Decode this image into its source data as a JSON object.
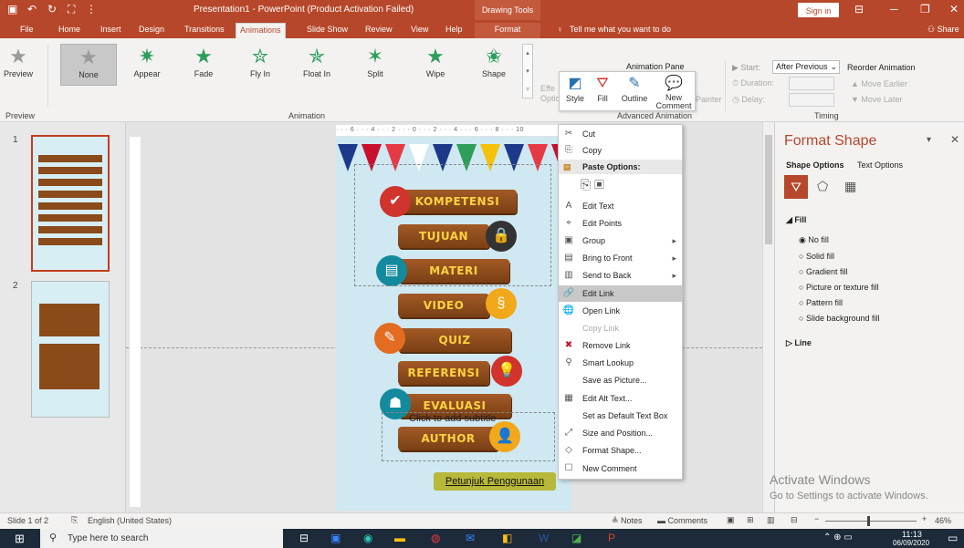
{
  "titlebar": {
    "title": "Presentation1 - PowerPoint (Product Activation Failed)",
    "context_header": "Drawing Tools",
    "signin": "Sign in",
    "accent": "#b7472a"
  },
  "tabs": [
    "File",
    "Home",
    "Insert",
    "Design",
    "Transitions",
    "Animations",
    "Slide Show",
    "Review",
    "View",
    "Help",
    "Format"
  ],
  "tell_me": "Tell me what you want to do",
  "share": "Share",
  "ribbon": {
    "preview_label": "Preview",
    "preview_group": "Preview",
    "animations": [
      "None",
      "Appear",
      "Fade",
      "Fly In",
      "Float In",
      "Split",
      "Wipe",
      "Shape"
    ],
    "animation_group": "Animation",
    "effect_label": "Effe Optio",
    "animation_pane": "Animation Pane",
    "painter": "Painter",
    "advanced_group": "Advanced Animation",
    "start_label": "Start:",
    "start_value": "After Previous",
    "duration_label": "Duration:",
    "delay_label": "Delay:",
    "reorder": "Reorder Animation",
    "move_earlier": "Move Earlier",
    "move_later": "Move Later",
    "timing_group": "Timing"
  },
  "minitoolbar": {
    "style": "Style",
    "fill": "Fill",
    "outline": "Outline",
    "comment": "New Comment"
  },
  "slides": {
    "nums": [
      "1",
      "2"
    ]
  },
  "slide": {
    "planks": [
      "KOMPETENSI",
      "TUJUAN",
      "MATERI",
      "VIDEO",
      "QUIZ",
      "REFERENSI",
      "EVALUASI",
      "AUTHOR"
    ],
    "placeholder": "Click to add subtitle",
    "petunjuk": "Petunjuk Penggunaan"
  },
  "ruler_top": "· · · 6 · · · 4 · · · 2 · · · 0 · · · 2 · · · 4 · · · 6 · · · 8 · · · 10",
  "context_menu": {
    "items1": [
      {
        "icon": "✂",
        "label": "Cut"
      },
      {
        "icon": "⎘",
        "label": "Copy"
      }
    ],
    "paste_header": "Paste Options:",
    "items2": [
      {
        "icon": "A",
        "label": "Edit Text",
        "arrow": ""
      },
      {
        "icon": "⌖",
        "label": "Edit Points",
        "arrow": ""
      },
      {
        "icon": "▣",
        "label": "Group",
        "arrow": "▸"
      },
      {
        "icon": "▤",
        "label": "Bring to Front",
        "arrow": "▸"
      },
      {
        "icon": "▥",
        "label": "Send to Back",
        "arrow": "▸"
      },
      {
        "icon": "🔗",
        "label": "Edit Link",
        "arrow": ""
      },
      {
        "icon": "🌐",
        "label": "Open Link",
        "arrow": ""
      },
      {
        "icon": "",
        "label": "Copy Link",
        "arrow": ""
      },
      {
        "icon": "✖",
        "label": "Remove Link",
        "arrow": ""
      },
      {
        "icon": "⚲",
        "label": "Smart Lookup",
        "arrow": ""
      },
      {
        "icon": "",
        "label": "Save as Picture...",
        "arrow": ""
      },
      {
        "icon": "▦",
        "label": "Edit Alt Text...",
        "arrow": ""
      },
      {
        "icon": "",
        "label": "Set as Default Text Box",
        "arrow": ""
      },
      {
        "icon": "⤢",
        "label": "Size and Position...",
        "arrow": ""
      },
      {
        "icon": "◇",
        "label": "Format Shape...",
        "arrow": ""
      },
      {
        "icon": "☐",
        "label": "New Comment",
        "arrow": ""
      }
    ]
  },
  "format_pane": {
    "title": "Format Shape",
    "tab_shape": "Shape Options",
    "tab_text": "Text Options",
    "fill_section": "Fill",
    "fill_options": [
      "No fill",
      "Solid fill",
      "Gradient fill",
      "Picture or texture fill",
      "Pattern fill",
      "Slide background fill"
    ],
    "line_section": "Line"
  },
  "watermark": {
    "line1": "Activate Windows",
    "line2": "Go to Settings to activate Windows."
  },
  "status": {
    "slide": "Slide 1 of 2",
    "lang": "English (United States)",
    "notes": "Notes",
    "comments": "Comments",
    "zoom": "46%"
  },
  "taskbar": {
    "search": "Type here to search",
    "time": "11:13",
    "date": "06/09/2020"
  }
}
